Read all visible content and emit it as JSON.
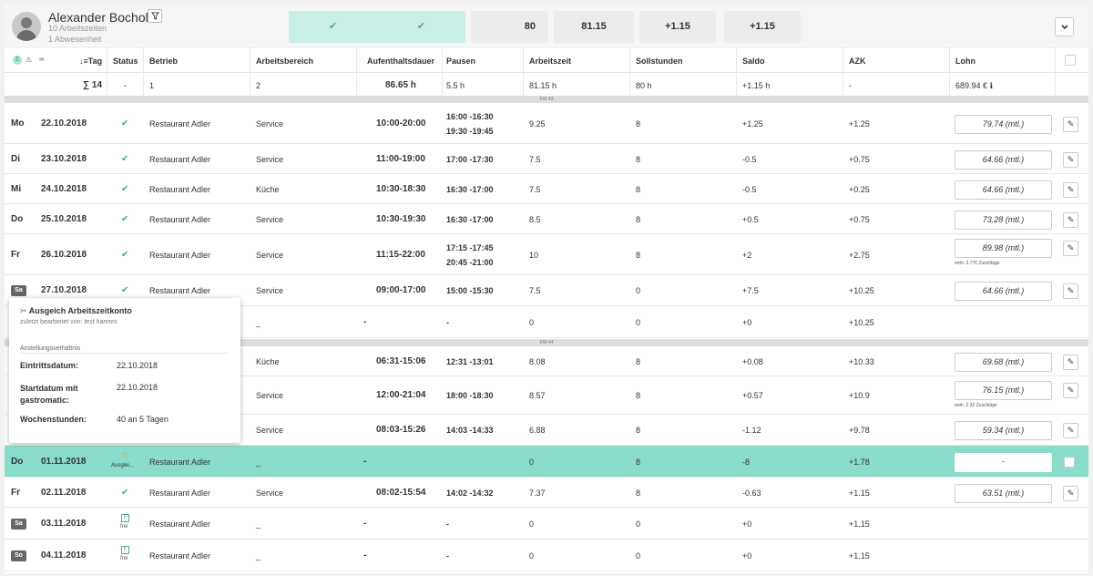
{
  "header": {
    "user_name": "Alexander Bocholt",
    "filter_icon": "filter-icon",
    "sub1": "10 Arbeitszeiten",
    "sub2": "1 Abwesenheit",
    "summary_boxes": [
      "✔",
      "✔",
      "80",
      "81.15",
      "+1.15",
      "+1.15"
    ],
    "expand_icon": "chevron-down-icon"
  },
  "columns": {
    "sort_tag": "↓≡Tag",
    "status": "Status",
    "betrieb": "Betrieb",
    "arbeitsbereich": "Arbeitsbereich",
    "aufenthaltsdauer": "Aufenthaltsdauer",
    "pausen": "Pausen",
    "arbeitszeit": "Arbeitszeit",
    "sollstunden": "Sollstunden",
    "saldo": "Saldo",
    "azk": "AZK",
    "lohn": "Lohn"
  },
  "summary": {
    "count": "∑ 14",
    "status": "-",
    "betrieb": "1",
    "arbeitsbereich": "2",
    "aufenthaltsdauer": "86.65 h",
    "pausen": "5.5 h",
    "arbeitszeit": "81.15 h",
    "sollstunden": "80 h",
    "saldo": "+1.15 h",
    "azk": "-",
    "lohn": "689.94 € ℹ"
  },
  "weeks": {
    "kw43": "KW 43",
    "kw44": "KW 44"
  },
  "rows": [
    {
      "day": "Mo",
      "date": "22.10.2018",
      "status": "✔",
      "betrieb": "Restaurant Adler",
      "bereich": "Service",
      "dauer": "10:00-20:00",
      "pausen": [
        "16:00 -16:30",
        "19:30 -19:45"
      ],
      "arbeitszeit": "9.25",
      "soll": "8",
      "saldo": "+1.25",
      "azk": "+1.25",
      "lohn": "79.74 (mtl.)",
      "note": ""
    },
    {
      "day": "Di",
      "date": "23.10.2018",
      "status": "✔",
      "betrieb": "Restaurant Adler",
      "bereich": "Service",
      "dauer": "11:00-19:00",
      "pausen": [
        "17:00 -17:30"
      ],
      "arbeitszeit": "7.5",
      "soll": "8",
      "saldo": "-0.5",
      "azk": "+0.75",
      "lohn": "64.66 (mtl.)",
      "note": ""
    },
    {
      "day": "Mi",
      "date": "24.10.2018",
      "status": "✔",
      "betrieb": "Restaurant Adler",
      "bereich": "Küche",
      "dauer": "10:30-18:30",
      "pausen": [
        "16:30 -17:00"
      ],
      "arbeitszeit": "7.5",
      "soll": "8",
      "saldo": "-0.5",
      "azk": "+0.25",
      "lohn": "64.66 (mtl.)",
      "note": ""
    },
    {
      "day": "Do",
      "date": "25.10.2018",
      "status": "✔",
      "betrieb": "Restaurant Adler",
      "bereich": "Service",
      "dauer": "10:30-19:30",
      "pausen": [
        "16:30 -17:00"
      ],
      "arbeitszeit": "8.5",
      "soll": "8",
      "saldo": "+0.5",
      "azk": "+0.75",
      "lohn": "73.28 (mtl.)",
      "note": ""
    },
    {
      "day": "Fr",
      "date": "26.10.2018",
      "status": "✔",
      "betrieb": "Restaurant Adler",
      "bereich": "Service",
      "dauer": "11:15-22:00",
      "pausen": [
        "17:15 -17:45",
        "20:45 -21:00"
      ],
      "arbeitszeit": "10",
      "soll": "8",
      "saldo": "+2",
      "azk": "+2.75",
      "lohn": "89.98 (mtl.)",
      "note": "enth. 3.77€ Zuschläge"
    },
    {
      "day": "Sa",
      "date": "27.10.2018",
      "status": "✔",
      "betrieb": "Restaurant Adler",
      "bereich": "Service",
      "dauer": "09:00-17:00",
      "pausen": [
        "15:00 -15:30"
      ],
      "arbeitszeit": "7.5",
      "soll": "0",
      "saldo": "+7.5",
      "azk": "+10.25",
      "lohn": "64.66 (mtl.)",
      "note": ""
    },
    {
      "day": "",
      "date": "",
      "status": "",
      "betrieb": "",
      "bereich": "_",
      "dauer": "-",
      "pausen": [
        "-"
      ],
      "arbeitszeit": "0",
      "soll": "0",
      "saldo": "+0",
      "azk": "+10.25",
      "lohn": "",
      "note": ""
    },
    {
      "day": "",
      "date": "",
      "status": "",
      "betrieb": "",
      "bereich": "Küche",
      "dauer": "06:31-15:06",
      "pausen": [
        "12:31 -13:01"
      ],
      "arbeitszeit": "8.08",
      "soll": "8",
      "saldo": "+0.08",
      "azk": "+10.33",
      "lohn": "69.68 (mtl.)",
      "note": ""
    },
    {
      "day": "",
      "date": "",
      "status": "",
      "betrieb": "",
      "bereich": "Service",
      "dauer": "12:00-21:04",
      "pausen": [
        "18:00 -18:30"
      ],
      "arbeitszeit": "8.57",
      "soll": "8",
      "saldo": "+0.57",
      "azk": "+10.9",
      "lohn": "76.15 (mtl.)",
      "note": "enth. 2.3€ Zuschläge"
    },
    {
      "day": "",
      "date": "",
      "status": "",
      "betrieb": "",
      "bereich": "Service",
      "dauer": "08:03-15:26",
      "pausen": [
        "14:03 -14:33"
      ],
      "arbeitszeit": "6.88",
      "soll": "8",
      "saldo": "-1.12",
      "azk": "+9.78",
      "lohn": "59.34 (mtl.)",
      "note": ""
    },
    {
      "day": "Do",
      "date": "01.11.2018",
      "status": "Ausglei...",
      "betrieb": "Restaurant Adler",
      "bereich": "_",
      "dauer": "-",
      "pausen": [
        ""
      ],
      "arbeitszeit": "0",
      "soll": "8",
      "saldo": "-8",
      "azk": "+1.78",
      "lohn": "-",
      "note": ""
    },
    {
      "day": "Fr",
      "date": "02.11.2018",
      "status": "✔",
      "betrieb": "Restaurant Adler",
      "bereich": "Service",
      "dauer": "08:02-15:54",
      "pausen": [
        "14:02 -14:32"
      ],
      "arbeitszeit": "7.37",
      "soll": "8",
      "saldo": "-0.63",
      "azk": "+1.15",
      "lohn": "63.51 (mtl.)",
      "note": ""
    },
    {
      "day": "Sa",
      "date": "03.11.2018",
      "status": "frei",
      "betrieb": "Restaurant Adler",
      "bereich": "_",
      "dauer": "-",
      "pausen": [
        "-"
      ],
      "arbeitszeit": "0",
      "soll": "0",
      "saldo": "+0",
      "azk": "+1.15",
      "lohn": "",
      "note": ""
    },
    {
      "day": "So",
      "date": "04.11.2018",
      "status": "frei",
      "betrieb": "Restaurant Adler",
      "bereich": "_",
      "dauer": "-",
      "pausen": [
        "-"
      ],
      "arbeitszeit": "0",
      "soll": "0",
      "saldo": "+0",
      "azk": "+1.15",
      "lohn": "",
      "note": ""
    }
  ],
  "popover": {
    "title": "Ausgeich Arbeitszeitkonto",
    "subtitle_prefix": "zuletzt bearbeitet von:",
    "subtitle_user": "test hannes",
    "section": "Anstellungsverhältnis",
    "fields": [
      {
        "label": "Eintrittsdatum:",
        "value": "22.10.2018"
      },
      {
        "label": "Startdatum mit gastromatic:",
        "value": "22.10.2018"
      },
      {
        "label": "Wochenstunden:",
        "value": "40 an 5 Tagen"
      }
    ]
  },
  "colors": {
    "accent": "#8adccb",
    "ok_box": "#c9f0e8",
    "check": "#4aa889",
    "warn": "#e0a44a"
  }
}
